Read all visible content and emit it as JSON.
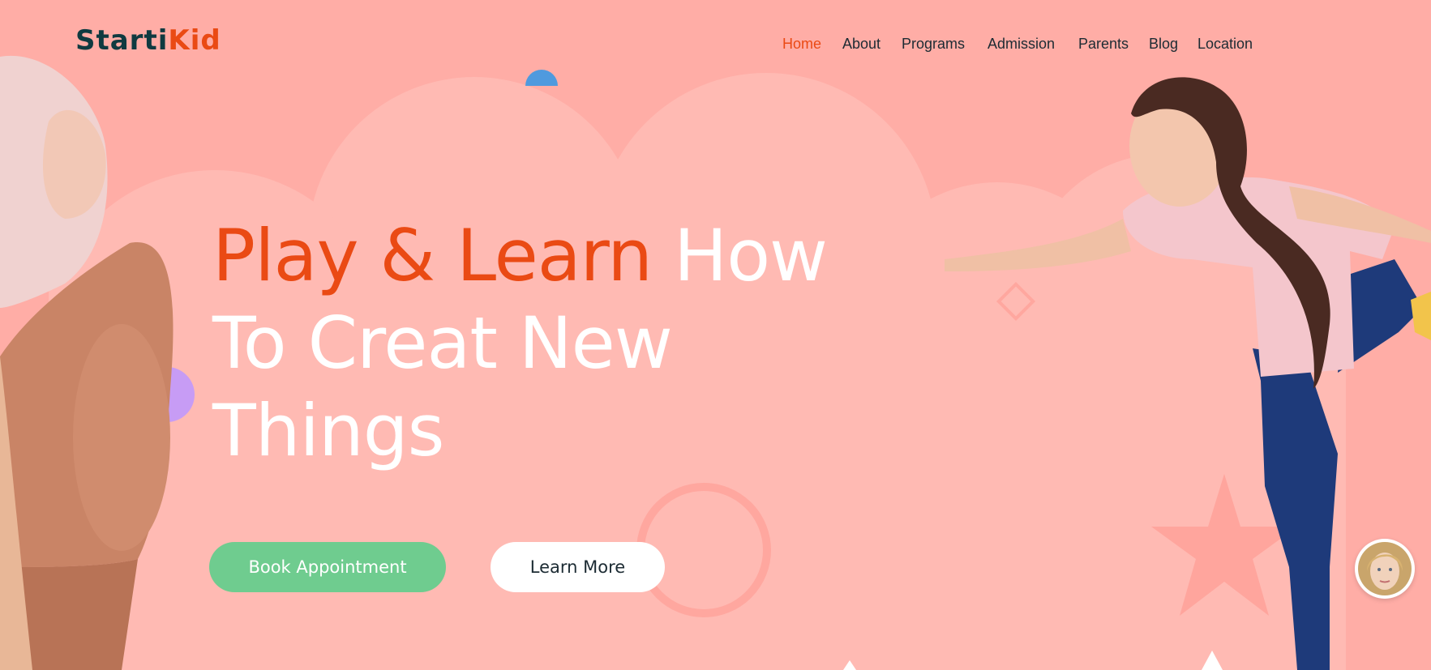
{
  "logo": {
    "part1": "Starti",
    "part2": "Kid"
  },
  "nav": {
    "items": [
      {
        "label": "Home",
        "active": true
      },
      {
        "label": "About",
        "active": false
      },
      {
        "label": "Programs",
        "active": false
      },
      {
        "label": "Admission",
        "active": false
      },
      {
        "label": "Parents",
        "active": false
      },
      {
        "label": "Blog",
        "active": false
      },
      {
        "label": "Location",
        "active": false
      }
    ]
  },
  "hero": {
    "title_highlight": "Play & Learn",
    "title_rest_line1": " How",
    "title_line2": "To Creat New",
    "title_line3": "Things"
  },
  "buttons": {
    "primary": "Book Appointment",
    "secondary": "Learn More"
  },
  "colors": {
    "background": "#ffada6",
    "cloud": "#ffbab3",
    "accent": "#ea4a14",
    "primary_button": "#6fcc8f",
    "dark_text": "#0f3a40"
  }
}
